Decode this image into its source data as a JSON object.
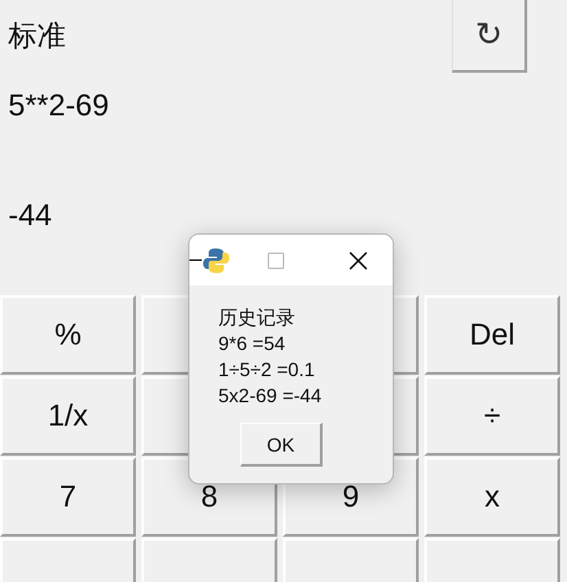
{
  "mode_title": "标准",
  "refresh_button": {
    "icon": "↻"
  },
  "expression": "5**2-69",
  "result": "-44",
  "keys": [
    {
      "label": "%"
    },
    {
      "kind": "covered"
    },
    {
      "kind": "covered"
    },
    {
      "label": "Del"
    },
    {
      "label": "1/x"
    },
    {
      "kind": "covered"
    },
    {
      "kind": "covered"
    },
    {
      "label": "÷"
    },
    {
      "label": "7"
    },
    {
      "label": "8"
    },
    {
      "label": "9"
    },
    {
      "label": "x"
    },
    {
      "kind": "covered"
    },
    {
      "kind": "covered"
    },
    {
      "kind": "covered"
    },
    {
      "kind": "covered"
    }
  ],
  "dialog": {
    "maximize_disabled": true,
    "heading": "历史记录",
    "lines": [
      "9*6 =54",
      "1÷5÷2 =0.1",
      "5x2-69 =-44"
    ],
    "button": "OK"
  }
}
